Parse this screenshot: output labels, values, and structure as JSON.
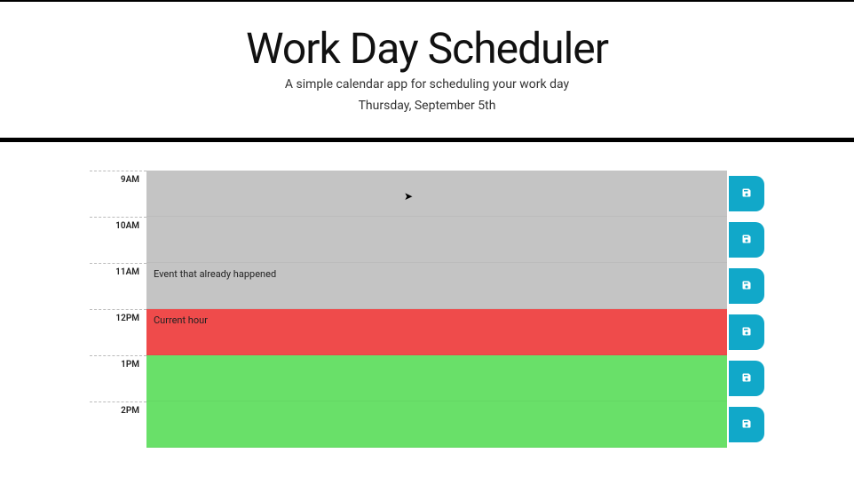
{
  "header": {
    "title": "Work Day Scheduler",
    "subtitle": "A simple calendar app for scheduling your work day",
    "date": "Thursday, September 5th"
  },
  "colors": {
    "past": "#c4c4c4",
    "present": "#ef4b4b",
    "future": "#69e069",
    "save": "#11a8c9"
  },
  "time_blocks": [
    {
      "hour": "9AM",
      "text": "",
      "state": "past"
    },
    {
      "hour": "10AM",
      "text": "",
      "state": "past"
    },
    {
      "hour": "11AM",
      "text": "Event that already happened",
      "state": "past"
    },
    {
      "hour": "12PM",
      "text": "Current hour",
      "state": "present"
    },
    {
      "hour": "1PM",
      "text": "",
      "state": "future"
    },
    {
      "hour": "2PM",
      "text": "",
      "state": "future"
    }
  ],
  "icons": {
    "save": "save-icon"
  }
}
